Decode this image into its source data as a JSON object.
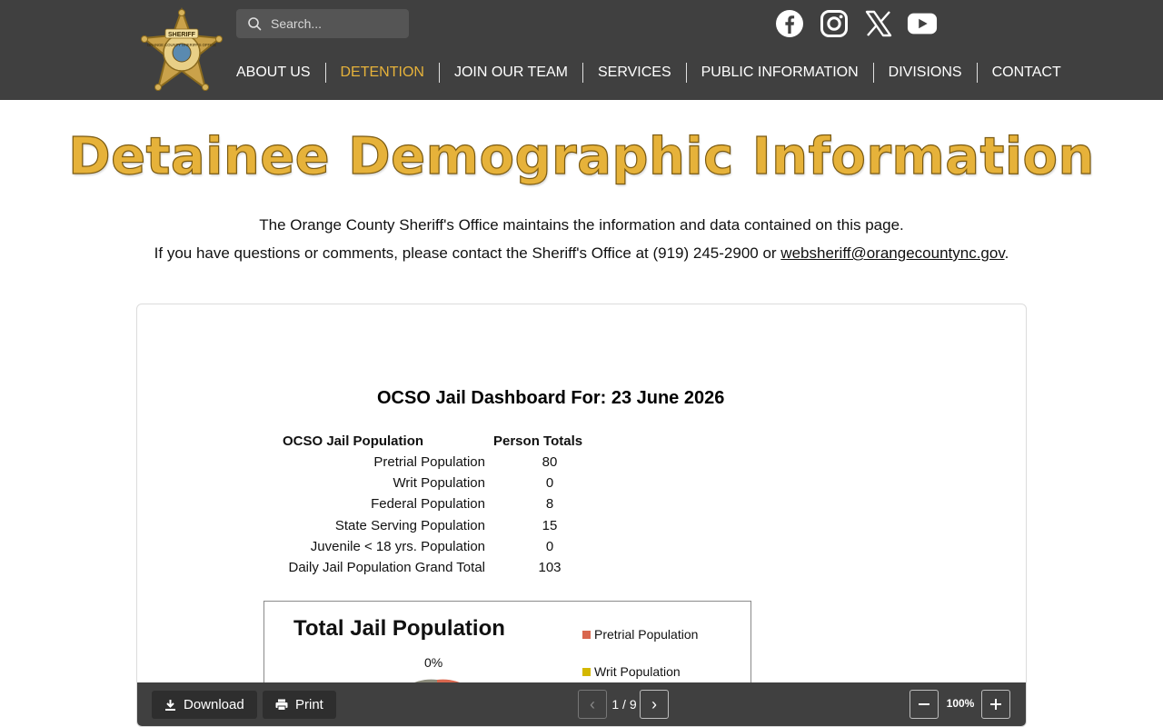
{
  "header": {
    "search_placeholder": "Search...",
    "social": [
      "facebook-icon",
      "instagram-icon",
      "x-icon",
      "youtube-icon"
    ],
    "nav": [
      {
        "label": "ABOUT US",
        "active": false
      },
      {
        "label": "DETENTION",
        "active": true
      },
      {
        "label": "JOIN OUR TEAM",
        "active": false
      },
      {
        "label": "SERVICES",
        "active": false
      },
      {
        "label": "PUBLIC INFORMATION",
        "active": false
      },
      {
        "label": "DIVISIONS",
        "active": false
      },
      {
        "label": "CONTACT",
        "active": false
      }
    ],
    "badge": {
      "top_text": "SHERIFF",
      "ring_text": "ORANGE COUNTY SHERIFF'S OFFICE"
    }
  },
  "page": {
    "title": "Detainee Demographic Information",
    "intro_line1": "The Orange County Sheriff's Office maintains the information and data contained on this page.",
    "intro_line2_prefix": "If you have questions or comments, please contact the Sheriff's Office at (919) 245-2900 or ",
    "email": "websheriff@orangecountync.gov",
    "intro_line2_suffix": "."
  },
  "document": {
    "title": "OCSO Jail Dashboard For: 23 June 2026",
    "col_population": "OCSO Jail Population",
    "col_totals": "Person Totals",
    "rows": [
      {
        "label": "Pretrial Population",
        "value": "80"
      },
      {
        "label": "Writ Population",
        "value": "0"
      },
      {
        "label": "Federal Population",
        "value": "8"
      },
      {
        "label": "State Serving Population",
        "value": "15"
      },
      {
        "label": "Juvenile < 18 yrs. Population",
        "value": "0"
      },
      {
        "label": "Daily Jail Population Grand Total",
        "value": "103"
      }
    ],
    "chart": {
      "title": "Total Jail Population",
      "pct_label": "0%",
      "legend": [
        {
          "label": "Pretrial Population",
          "color": "#d9674e"
        },
        {
          "label": "Writ Population",
          "color": "#d4b800"
        }
      ]
    }
  },
  "toolbar": {
    "download": "Download",
    "print": "Print",
    "page_indicator": "1 / 9",
    "zoom": "100%"
  },
  "colors": {
    "header_bg": "#404040",
    "accent": "#e6b23a"
  }
}
